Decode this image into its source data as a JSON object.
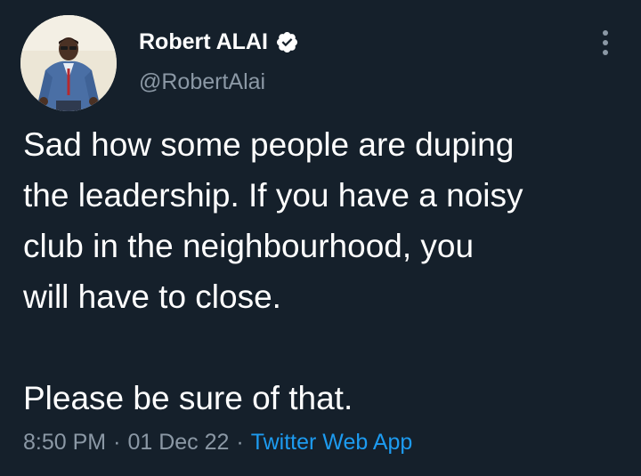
{
  "author": {
    "display_name": "Robert ALAI",
    "handle": "@RobertAlai",
    "verified": true
  },
  "menu": {
    "icon": "more-vertical-icon"
  },
  "tweet": {
    "lines": [
      "Sad how some people are duping",
      "the leadership. If you have a noisy",
      "club in the neighbourhood, you",
      "will have to close."
    ],
    "closing_line": "Please be sure of that."
  },
  "meta": {
    "time": "8:50 PM",
    "separator": "·",
    "date": "01 Dec 22",
    "source": "Twitter Web App"
  },
  "colors": {
    "background": "#15202b",
    "text": "#ffffff",
    "secondary": "#8b98a5",
    "link": "#1d9bf0"
  }
}
